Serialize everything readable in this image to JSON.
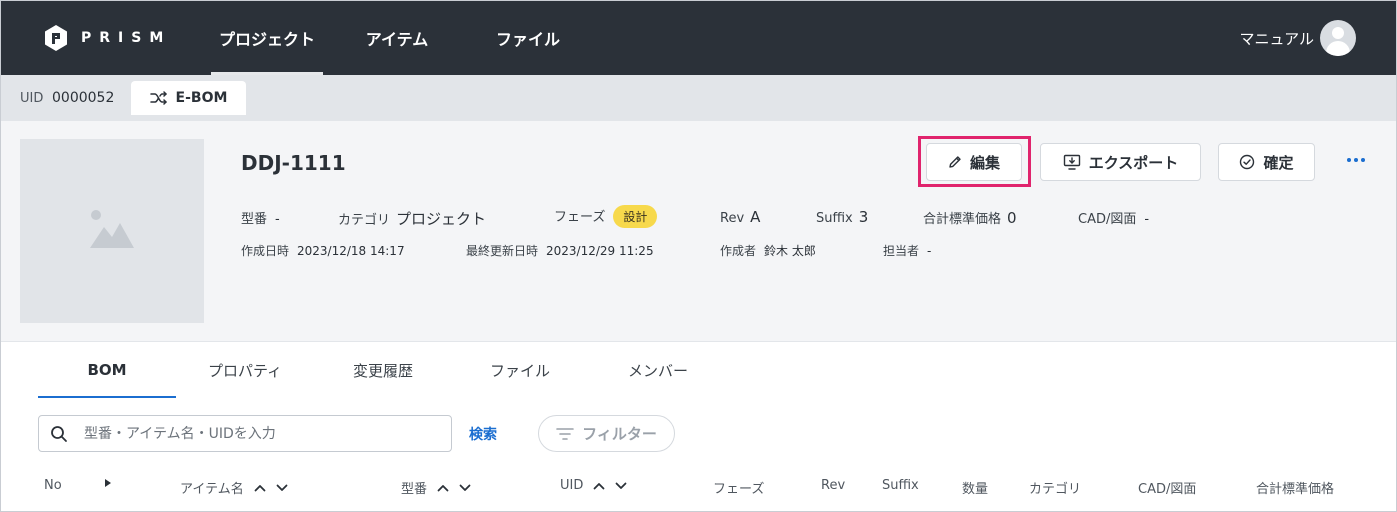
{
  "app": {
    "logo_text": "PRISM"
  },
  "nav": {
    "tabs": [
      {
        "label": "プロジェクト",
        "active": true
      },
      {
        "label": "アイテム",
        "active": false
      },
      {
        "label": "ファイル",
        "active": false
      }
    ],
    "user_name": "マニュアル"
  },
  "subbar": {
    "uid_label": "UID",
    "uid_value": "0000052",
    "bom_type": "E-BOM"
  },
  "item": {
    "title": "DDJ-1111",
    "actions": {
      "edit": "編集",
      "export": "エクスポート",
      "confirm": "確定"
    },
    "meta_row1": {
      "model_label": "型番",
      "model_value": "-",
      "category_label": "カテゴリ",
      "category_value": "プロジェクト",
      "phase_label": "フェーズ",
      "phase_value": "設計",
      "rev_label": "Rev",
      "rev_value": "A",
      "suffix_label": "Suffix",
      "suffix_value": "3",
      "price_label": "合計標準価格",
      "price_value": "0",
      "cad_label": "CAD/図面",
      "cad_value": "-"
    },
    "meta_row2": {
      "created_label": "作成日時",
      "created_value": "2023/12/18 14:17",
      "updated_label": "最終更新日時",
      "updated_value": "2023/12/29 11:25",
      "author_label": "作成者",
      "author_value": "鈴木 太郎",
      "owner_label": "担当者",
      "owner_value": "-"
    }
  },
  "tabs": [
    {
      "label": "BOM",
      "active": true
    },
    {
      "label": "プロパティ",
      "active": false
    },
    {
      "label": "変更履歴",
      "active": false
    },
    {
      "label": "ファイル",
      "active": false
    },
    {
      "label": "メンバー",
      "active": false
    }
  ],
  "search": {
    "placeholder": "型番・アイテム名・UIDを入力",
    "button": "検索",
    "filter": "フィルター"
  },
  "table": {
    "columns": [
      "No",
      "アイテム名",
      "型番",
      "UID",
      "フェーズ",
      "Rev",
      "Suffix",
      "数量",
      "カテゴリ",
      "CAD/図面",
      "合計標準価格"
    ]
  },
  "colors": {
    "nav_bg": "#2b3139",
    "accent": "#1b6ed0",
    "phase_badge": "#f7d94c",
    "highlight": "#e0246d"
  }
}
